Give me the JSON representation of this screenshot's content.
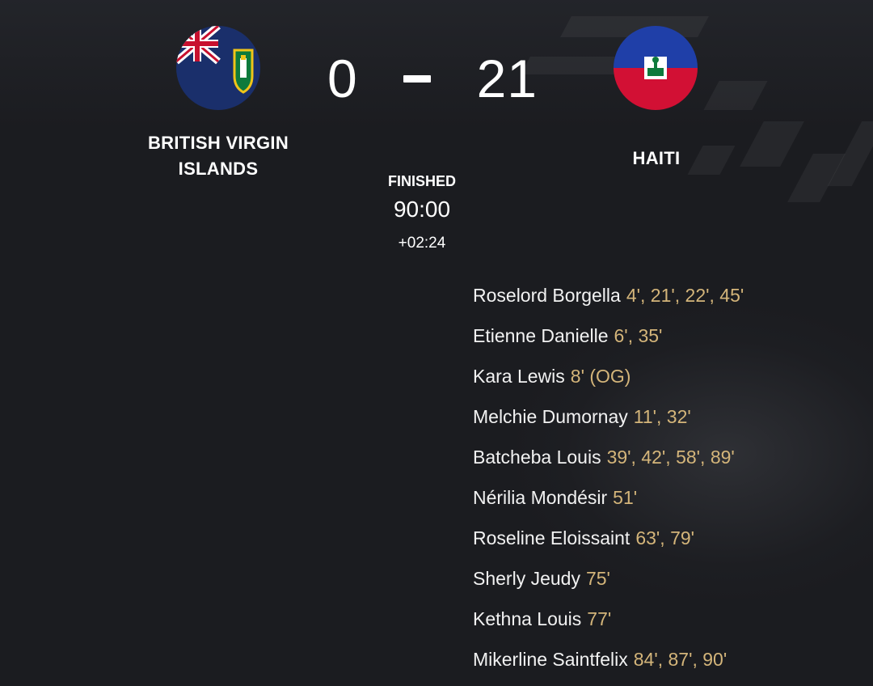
{
  "match": {
    "home": {
      "name_line1": "BRITISH VIRGIN",
      "name_line2": "ISLANDS",
      "flag_icon": "british-virgin-islands-flag-icon"
    },
    "away": {
      "name": "HAITI",
      "flag_icon": "haiti-flag-icon"
    },
    "score": {
      "home": "0",
      "away": "21"
    },
    "status": "FINISHED",
    "clock": "90:00",
    "added_time": "+02:24"
  },
  "scorers": [
    {
      "player": "Roselord Borgella",
      "minutes": "4', 21', 22', 45'"
    },
    {
      "player": "Etienne Danielle",
      "minutes": "6', 35'"
    },
    {
      "player": "Kara Lewis",
      "minutes": "8' (OG)"
    },
    {
      "player": "Melchie Dumornay",
      "minutes": "11', 32'"
    },
    {
      "player": "Batcheba Louis",
      "minutes": "39', 42', 58', 89'"
    },
    {
      "player": "Nérilia Mondésir",
      "minutes": "51'"
    },
    {
      "player": "Roseline Eloissaint",
      "minutes": "63', 79'"
    },
    {
      "player": "Sherly Jeudy",
      "minutes": "75'"
    },
    {
      "player": "Kethna Louis",
      "minutes": "77'"
    },
    {
      "player": "Mikerline Saintfelix",
      "minutes": "84', 87', 90'"
    }
  ],
  "colors": {
    "background": "#1b1c20",
    "minutes_accent": "#d4b57a",
    "haiti_blue": "#1f3fa8",
    "haiti_red": "#d21034",
    "bvi_blue": "#1a2f6b"
  }
}
